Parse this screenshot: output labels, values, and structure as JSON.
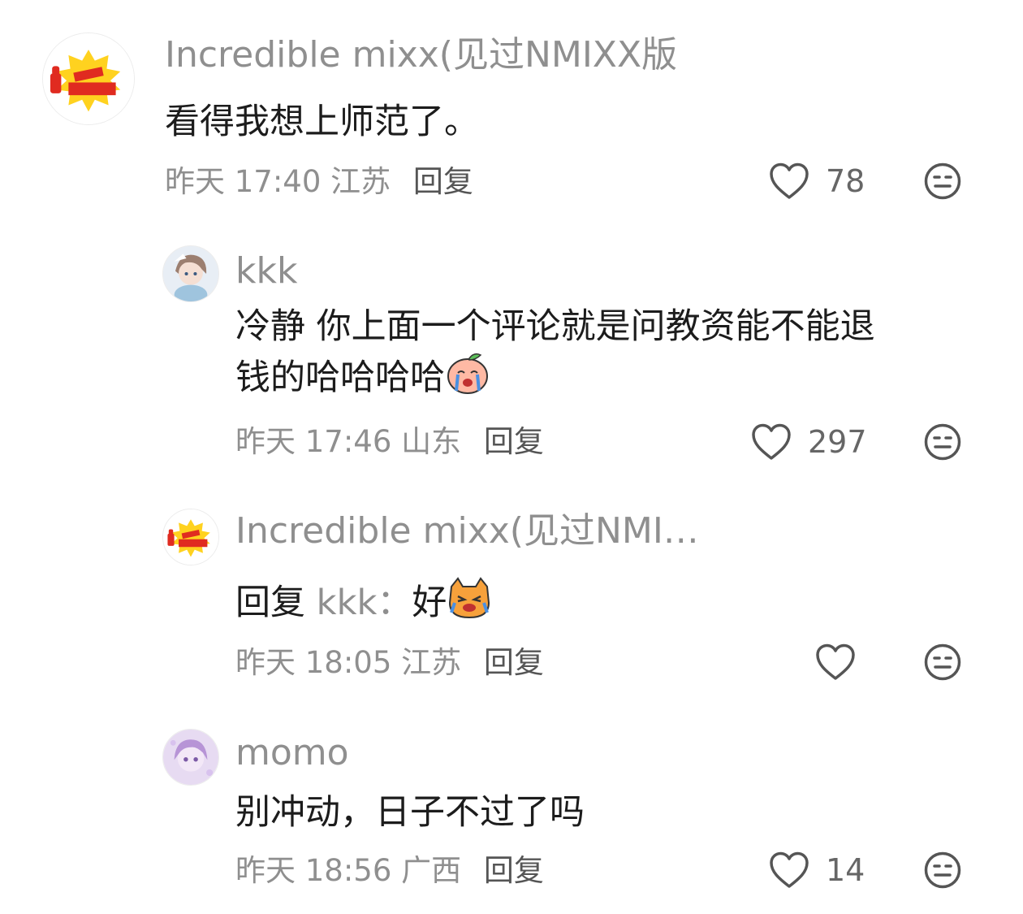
{
  "comments": [
    {
      "username": "Incredible mixx(见过NMIXX版",
      "text": "看得我想上师范了。",
      "time": "昨天 17:40",
      "location": "江苏",
      "reply_label": "回复",
      "likes": "78",
      "avatar": "thumbs-up-sticker-avatar"
    },
    {
      "username": "kkk",
      "text_line1": "冷静 你上面一个评论就是问教资能不能退",
      "text_line2": "钱的哈哈哈哈",
      "emoji": "crying-peach-emoji",
      "time": "昨天 17:46",
      "location": "山东",
      "reply_label": "回复",
      "likes": "297",
      "avatar": "anime-girl-avatar"
    },
    {
      "username": "Incredible mixx(见过NMI…",
      "reply_prefix": "回复",
      "reply_target": "kkk：",
      "text": "好",
      "emoji": "crying-cat-emoji",
      "time": "昨天 18:05",
      "location": "江苏",
      "reply_label": "回复",
      "likes": "",
      "avatar": "thumbs-up-sticker-avatar"
    },
    {
      "username": "momo",
      "text": "别冲动，日子不过了吗",
      "time": "昨天 18:56",
      "location": "广西",
      "reply_label": "回复",
      "likes": "14",
      "avatar": "purple-anime-avatar"
    }
  ],
  "colors": {
    "meta_gray": "#8f8f8f",
    "text_dark": "#1c1c1c",
    "icon_gray": "#555555"
  }
}
